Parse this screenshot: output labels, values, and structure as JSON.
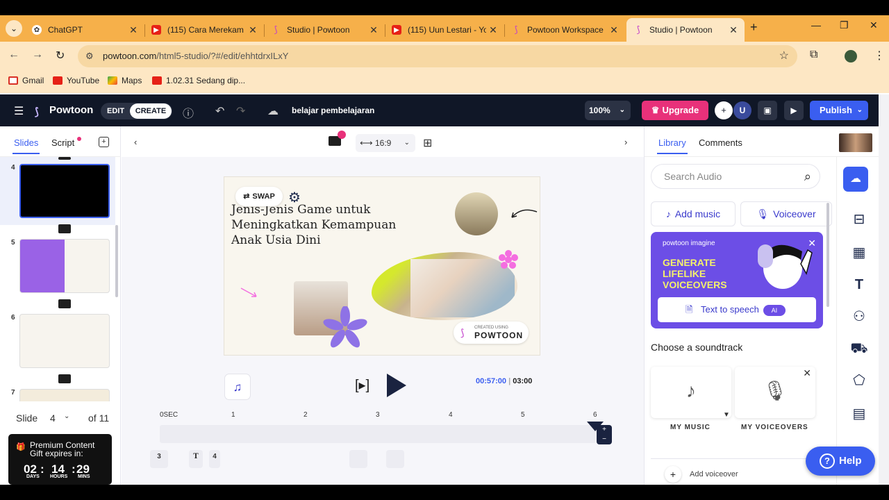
{
  "browser": {
    "tabs": [
      {
        "title": "ChatGPT",
        "icon": "chatgpt-icon"
      },
      {
        "title": "(115) Cara Merekam Laya",
        "icon": "youtube-icon"
      },
      {
        "title": "Studio | Powtoon",
        "icon": "powtoon-icon"
      },
      {
        "title": "(115) Uun Lestari - Yo",
        "icon": "youtube-icon"
      },
      {
        "title": "Powtoon Workspace",
        "icon": "powtoon-icon"
      },
      {
        "title": "Studio | Powtoon",
        "icon": "powtoon-icon",
        "active": true
      }
    ],
    "url_host": "powtoon.com",
    "url_path": "/html5-studio/?#/edit/ehhtdrxILxY",
    "bookmarks": [
      "Gmail",
      "YouTube",
      "Maps",
      "1.02.31 Sedang dip..."
    ]
  },
  "app": {
    "logo": "Powtoon",
    "mode_edit": "EDIT",
    "mode_create": "CREATE",
    "project_name": "belajar pembelajaran",
    "zoom": "100%",
    "upgrade": "Upgrade",
    "avatar_initial": "U",
    "publish": "Publish"
  },
  "left": {
    "tab_slides": "Slides",
    "tab_script": "Script",
    "slides": [
      {
        "num": "4"
      },
      {
        "num": "5"
      },
      {
        "num": "6"
      },
      {
        "num": "7"
      }
    ],
    "pager_label": "Slide",
    "pager_value": "4",
    "pager_total": "of 11",
    "gift_line1": "Premium Content",
    "gift_line2": "Gift expires in:",
    "countdown": {
      "days": "02",
      "hours": "14",
      "mins": "29",
      "days_label": "DAYS",
      "hours_label": "HOURS",
      "mins_label": "MINS"
    }
  },
  "center": {
    "aspect": "16:9",
    "slide_title": "Jenis-Jenis Game untuk Meningkatkan Kemampuan Anak Usia Dini",
    "swap_label": "SWAP",
    "badge_top": "CREATED USING",
    "badge_main": "POWTOON",
    "time_current": "00:57:00",
    "time_total": "03:00",
    "ruler": [
      "0SEC",
      "1",
      "2",
      "3",
      "4",
      "5",
      "6"
    ],
    "chips": [
      "3",
      "T",
      "4"
    ]
  },
  "right": {
    "tab_library": "Library",
    "tab_comments": "Comments",
    "search_placeholder": "Search Audio",
    "add_music": "Add music",
    "voiceover": "Voiceover",
    "promo_brand": "powtoon imagine",
    "promo_headline": "GENERATE LIFELIKE VOICEOVERS",
    "promo_button": "Text to speech",
    "promo_ai": "AI",
    "choose_soundtrack": "Choose a soundtrack",
    "my_music": "MY MUSIC",
    "my_voiceovers": "MY VOICEOVERS",
    "add_voiceover": "Add voiceover",
    "help": "Help"
  },
  "colors": {
    "tabstrip": "#f6b04a",
    "header_bg": "#101727",
    "accent_blue": "#3a5ef0",
    "upgrade_pink": "#e8317a",
    "promo_purple": "#6c4ee6"
  }
}
